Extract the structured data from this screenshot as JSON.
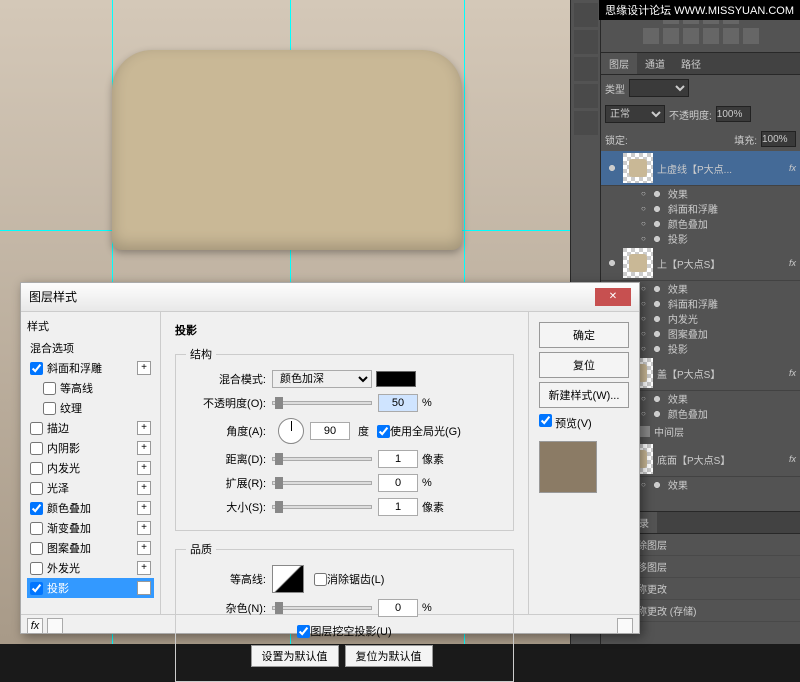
{
  "watermark": "思缘设计论坛 WWW.MISSYUAN.COM",
  "panels": {
    "tabs": {
      "layers": "图层",
      "channels": "通道",
      "paths": "路径"
    },
    "kind_label": "类型",
    "blend_mode": "正常",
    "opacity_label": "不透明度:",
    "opacity_value": "100%",
    "lock_label": "锁定:",
    "fill_label": "填充:",
    "fill_value": "100%",
    "layers": [
      {
        "name": "上虚线【P大点...",
        "selected": true,
        "fx": [
          "效果",
          "斜面和浮雕",
          "颜色叠加",
          "投影"
        ]
      },
      {
        "name": "上【P大点S】",
        "fx": [
          "效果",
          "斜面和浮雕",
          "内发光",
          "图案叠加",
          "投影"
        ]
      },
      {
        "name": "盖【P大点S】",
        "fx": [
          "效果",
          "颜色叠加"
        ]
      },
      {
        "name": "中间层",
        "folder": true
      },
      {
        "name": "底面【P大点S】",
        "fx": [
          "效果"
        ]
      }
    ]
  },
  "history": {
    "title": "历史记录",
    "items": [
      "删除图层",
      "拖移图层",
      "名称更改",
      "名称更改 (存储)"
    ]
  },
  "dialog": {
    "title": "图层样式",
    "styles_heading": "样式",
    "blend_options": "混合选项",
    "styles": [
      {
        "label": "斜面和浮雕",
        "checked": true
      },
      {
        "label": "等高线",
        "checked": false,
        "indent": true
      },
      {
        "label": "纹理",
        "checked": false,
        "indent": true
      },
      {
        "label": "描边",
        "checked": false
      },
      {
        "label": "内阴影",
        "checked": false
      },
      {
        "label": "内发光",
        "checked": false
      },
      {
        "label": "光泽",
        "checked": false
      },
      {
        "label": "颜色叠加",
        "checked": true
      },
      {
        "label": "渐变叠加",
        "checked": false
      },
      {
        "label": "图案叠加",
        "checked": false
      },
      {
        "label": "外发光",
        "checked": false
      },
      {
        "label": "投影",
        "checked": true,
        "selected": true
      }
    ],
    "section_title": "投影",
    "structure": "结构",
    "blend_mode_label": "混合模式:",
    "blend_mode_value": "颜色加深",
    "opacity_label": "不透明度(O):",
    "opacity_value": "50",
    "angle_label": "角度(A):",
    "angle_value": "90",
    "angle_unit": "度",
    "global_light": "使用全局光(G)",
    "distance_label": "距离(D):",
    "distance_value": "1",
    "distance_unit": "像素",
    "spread_label": "扩展(R):",
    "spread_value": "0",
    "spread_unit": "%",
    "size_label": "大小(S):",
    "size_value": "1",
    "size_unit": "像素",
    "quality": "品质",
    "contour_label": "等高线:",
    "antialias": "消除锯齿(L)",
    "noise_label": "杂色(N):",
    "noise_value": "0",
    "noise_unit": "%",
    "knockout": "图层挖空投影(U)",
    "make_default": "设置为默认值",
    "reset_default": "复位为默认值",
    "buttons": {
      "ok": "确定",
      "cancel": "复位",
      "new_style": "新建样式(W)...",
      "preview": "预览(V)"
    }
  }
}
